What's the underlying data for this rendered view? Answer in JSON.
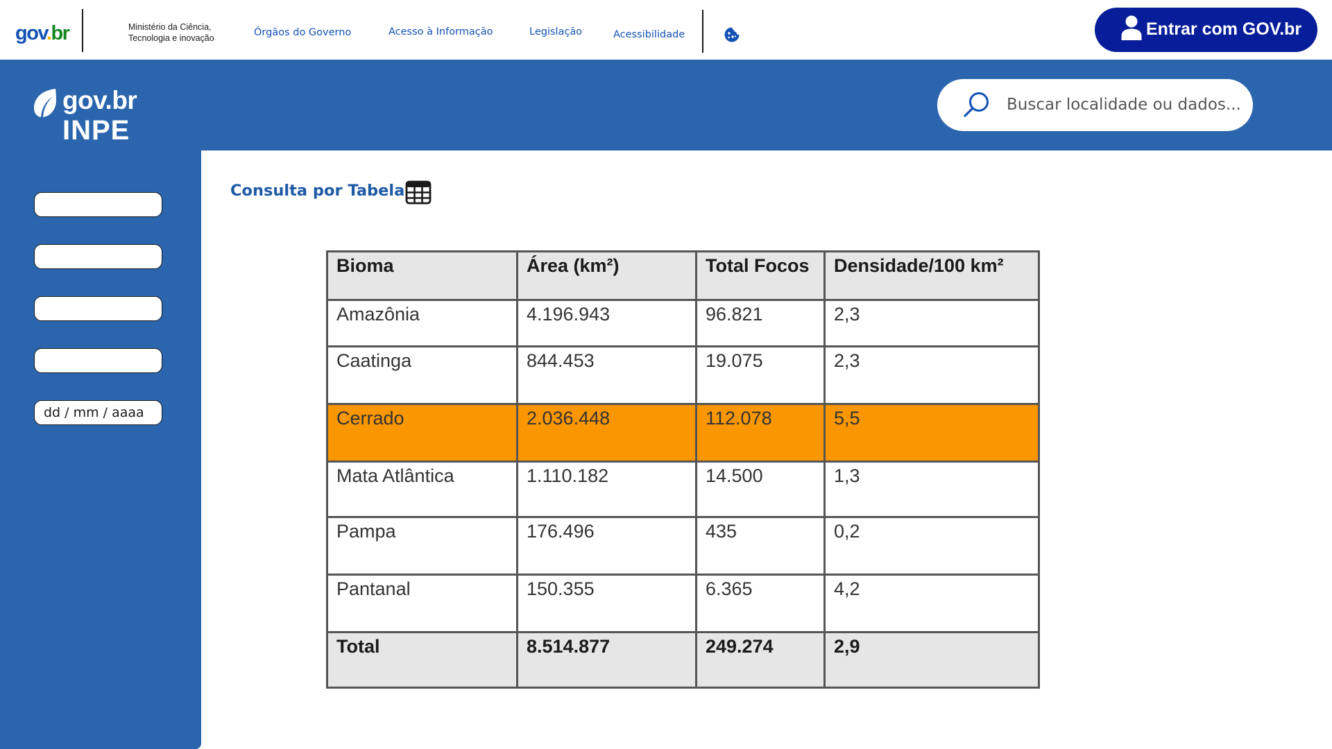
{
  "topbar": {
    "logo": {
      "part1": "gov",
      "part2": ".",
      "part3": "br"
    },
    "ministry_line1": "Ministério da Ciência,",
    "ministry_line2": "Tecnologia e inovação",
    "nav": [
      {
        "label": "Órgãos do Governo"
      },
      {
        "label": "Acesso à Informação"
      },
      {
        "label": "Legislação"
      },
      {
        "label": "Acessibilidade"
      }
    ],
    "login_label": "Entrar com GOV.br"
  },
  "header": {
    "logo_line1": "gov.br",
    "logo_line2": "INPE",
    "search_placeholder": "Buscar localidade ou dados..."
  },
  "sidebar": {
    "fields": [
      {
        "value": ""
      },
      {
        "value": ""
      },
      {
        "value": ""
      },
      {
        "value": ""
      },
      {
        "placeholder": "dd / mm / aaaa"
      }
    ]
  },
  "main": {
    "title": "Consulta por Tabela",
    "table": {
      "headers": [
        "Bioma",
        "Área (km²)",
        "Total Focos",
        "Densidade/100 km²"
      ],
      "rows": [
        [
          "Amazônia",
          "4.196.943",
          "96.821",
          "2,3"
        ],
        [
          "Caatinga",
          "844.453",
          "19.075",
          "2,3"
        ],
        [
          "Cerrado",
          "2.036.448",
          "112.078",
          "5,5"
        ],
        [
          "Mata Atlântica",
          "1.110.182",
          "14.500",
          "1,3"
        ],
        [
          "Pampa",
          "176.496",
          "435",
          "0,2"
        ],
        [
          "Pantanal",
          "150.355",
          "6.365",
          "4,2"
        ]
      ],
      "total": [
        "Total",
        "8.514.877",
        "249.274",
        "2,9"
      ],
      "highlight_color": "#fa9600"
    }
  },
  "colors": {
    "primary_blue": "#2a65ad",
    "login_button": "#071d99",
    "link_blue": "#1351b4"
  },
  "icons": [
    "cookie-icon",
    "user-icon",
    "leaf-icon",
    "search-icon",
    "table-icon"
  ]
}
